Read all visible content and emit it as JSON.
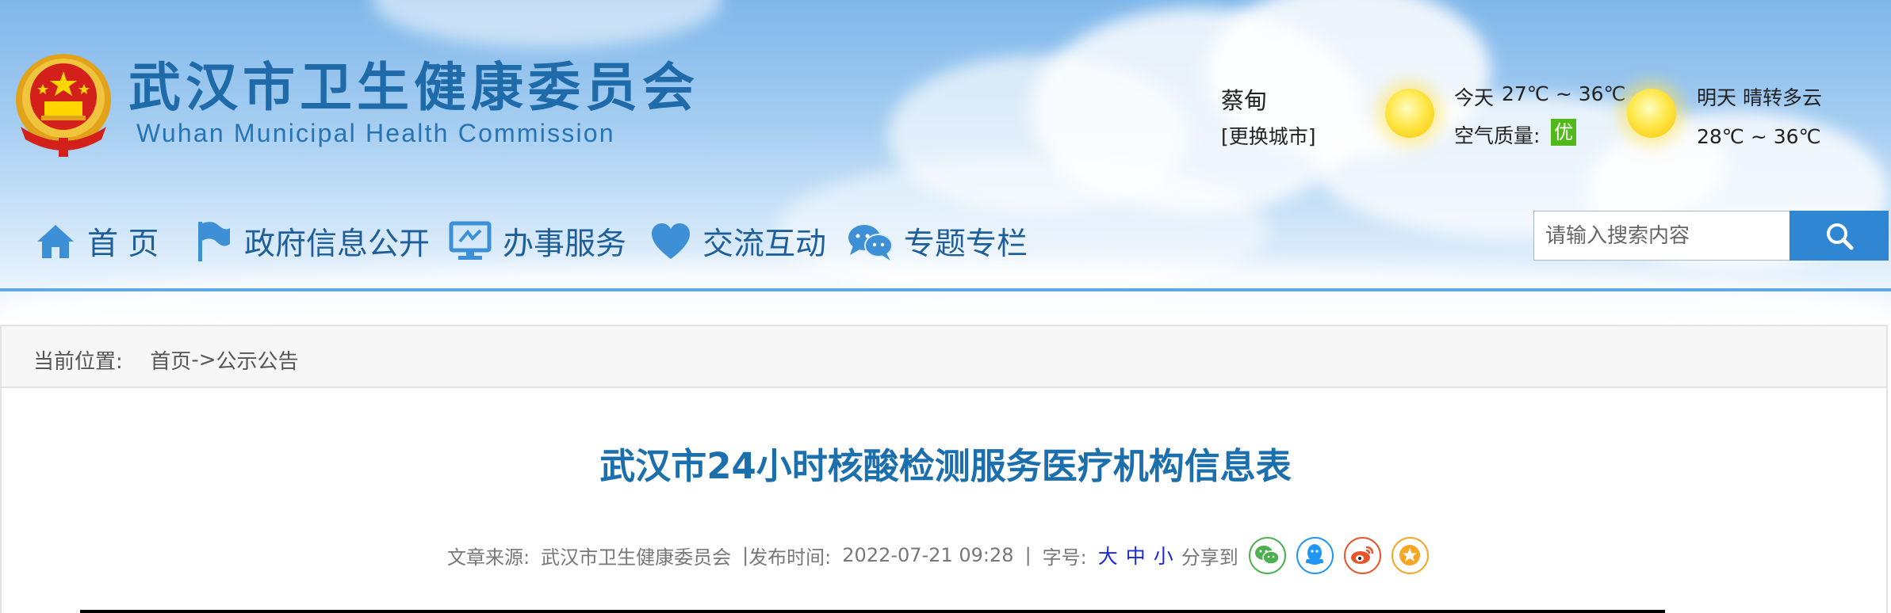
{
  "site": {
    "title_cn": "武汉市卫生健康委员会",
    "title_en": "Wuhan Municipal Health Commission"
  },
  "weather": {
    "city": "蔡甸",
    "change_city": "[更换城市]",
    "today_label": "今天",
    "today_temp": "27℃ ~ 36℃",
    "air_quality_label": "空气质量:",
    "air_quality_value": "优",
    "tomorrow_label": "明天",
    "tomorrow_condition": "晴转多云",
    "tomorrow_temp": "28℃ ~ 36℃",
    "colors": {
      "air_good": "#52b91a",
      "sun": "#ffe84a"
    }
  },
  "nav": {
    "items": [
      {
        "label": "首 页",
        "icon": "home-icon"
      },
      {
        "label": "政府信息公开",
        "icon": "flag-icon"
      },
      {
        "label": "办事服务",
        "icon": "monitor-icon"
      },
      {
        "label": "交流互动",
        "icon": "heart-icon"
      },
      {
        "label": "专题专栏",
        "icon": "chat-bubbles-icon"
      }
    ],
    "search_placeholder": "请输入搜索内容",
    "search_icon": "search-icon",
    "color": "#1e5f9a",
    "accent": "#2f86d2"
  },
  "breadcrumb": {
    "label": "当前位置:",
    "home": "首页",
    "separator": "->",
    "current": "公示公告"
  },
  "article": {
    "title": "武汉市24小时核酸检测服务医疗机构信息表",
    "source_label": "文章来源:",
    "source": "武汉市卫生健康委员会",
    "divider": "|",
    "date_label": "发布时间:",
    "date": "2022-07-21 09:28",
    "font_label": "字号:",
    "font_sizes": [
      "大",
      "中",
      "小"
    ],
    "share_label": "分享到",
    "share_icons": [
      "wechat-icon",
      "qq-icon",
      "weibo-icon",
      "favorite-star-icon"
    ],
    "title_color": "#1c6fad"
  }
}
